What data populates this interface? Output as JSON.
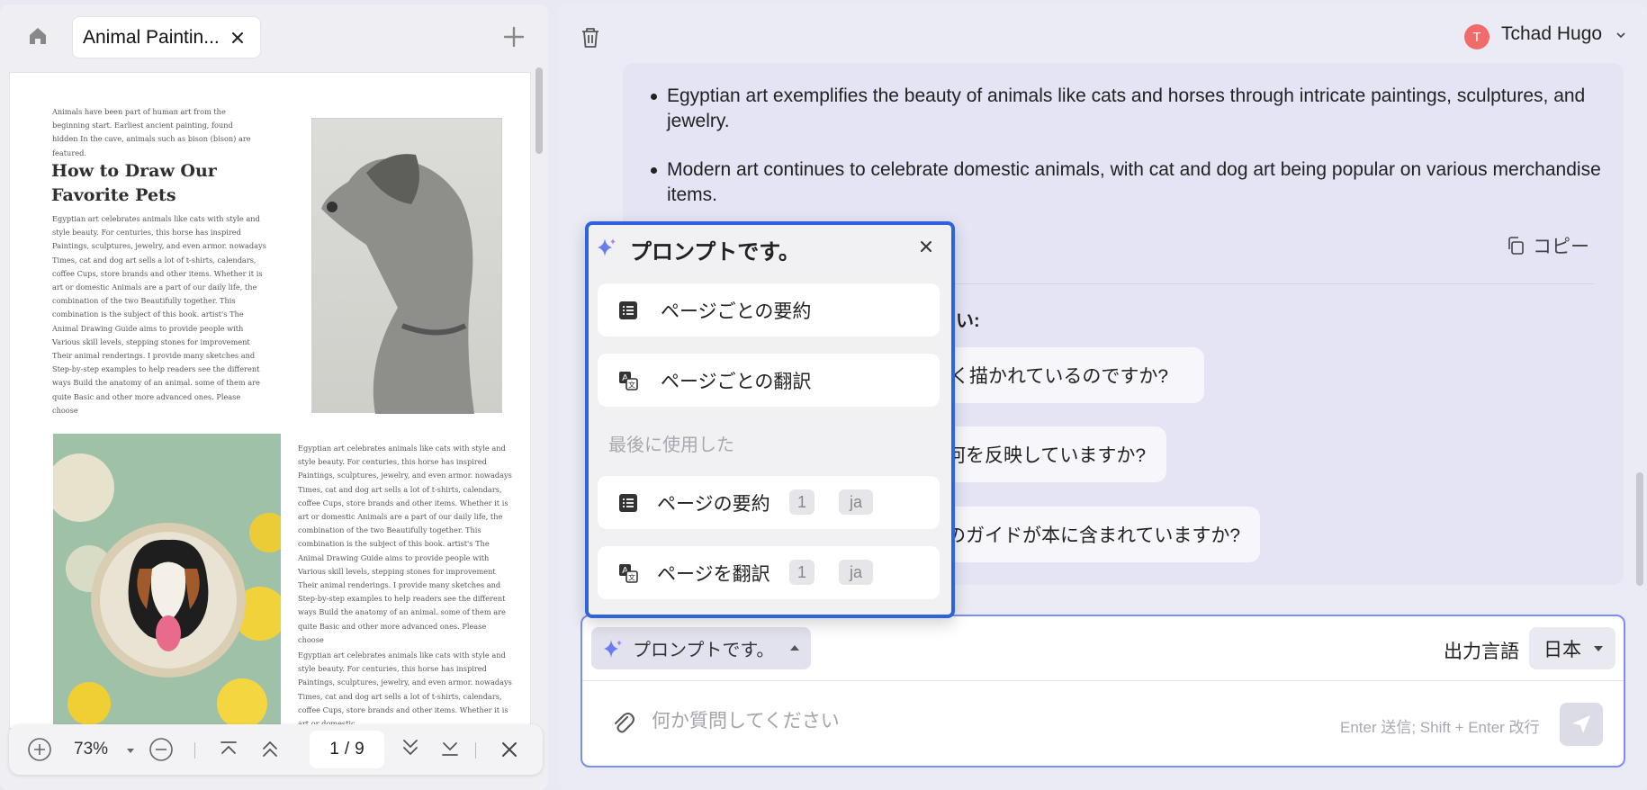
{
  "left_panel": {
    "tab_title": "Animal Paintin...",
    "document": {
      "intro": "Animals have been part of human art from the beginning start. Earliest ancient painting, found hidden In the cave, animals such as bison (bison) are featured.",
      "heading": "How to Draw Our Favorite Pets",
      "body": "Egyptian art celebrates animals like cats with style and style beauty. For centuries, this horse has inspired Paintings, sculptures, jewelry, and even armor. nowadays Times, cat and dog art sells a lot of t-shirts, calendars, coffee Cups, store brands and other items. Whether it is art or domestic Animals are a part of our daily life, the combination of the two Beautifully together. This combination is the subject of this book. artist's The Animal Drawing Guide aims to provide people with Various skill levels, stepping stones for improvement Their animal renderings. I provide many sketches and Step-by-step examples to help readers see the different ways Build the anatomy of an animal. some of them are quite Basic and other more advanced ones. Please choose",
      "body_partial": "Egyptian art celebrates animals like cats with style and style beauty. For centuries, this horse has inspired Paintings, sculptures, jewelry, and even armor. nowadays Times, cat and dog art sells a lot of t-shirts, calendars, coffee Cups, store brands and other items. Whether it is art or domestic"
    },
    "toolbar": {
      "zoom": "73%",
      "page_current": "1",
      "page_sep": "/",
      "page_total": "9"
    }
  },
  "right_panel": {
    "user": {
      "initial": "T",
      "name": "Tchad Hugo"
    },
    "chat": {
      "bullets": [
        "Egyptian art exemplifies the beauty of animals like cats and horses through intricate paintings, sculptures, and jewelry.",
        "Modern art continues to celebrate domestic animals, with cat and dog art being popular on various merchandise items."
      ],
      "copy_label": "コピー",
      "suggest_label_visible": "い:",
      "suggestions_visible": [
        "く描かれているのですか?",
        "何を反映していますか?",
        "のガイドが本に含まれていますか?"
      ]
    },
    "input": {
      "prompt_button": "プロンプトです。",
      "output_lang_label": "出力言語",
      "output_lang_value": "日本",
      "placeholder": "何か質問してください",
      "hint": "Enter 送信; Shift + Enter 改行"
    }
  },
  "popup": {
    "title": "プロンプトです。",
    "items": [
      {
        "label": "ページごとの要約",
        "icon": "list-icon"
      },
      {
        "label": "ページごとの翻訳",
        "icon": "translate-icon"
      }
    ],
    "recent_label": "最後に使用した",
    "recent": [
      {
        "label": "ページの要約",
        "icon": "list-icon",
        "page": "1",
        "lang": "ja"
      },
      {
        "label": "ページを翻訳",
        "icon": "translate-icon",
        "page": "1",
        "lang": "ja"
      }
    ]
  },
  "colors": {
    "accent_blue": "#2f63de",
    "avatar": "#f26b6b",
    "input_border": "#7c8cf0"
  }
}
